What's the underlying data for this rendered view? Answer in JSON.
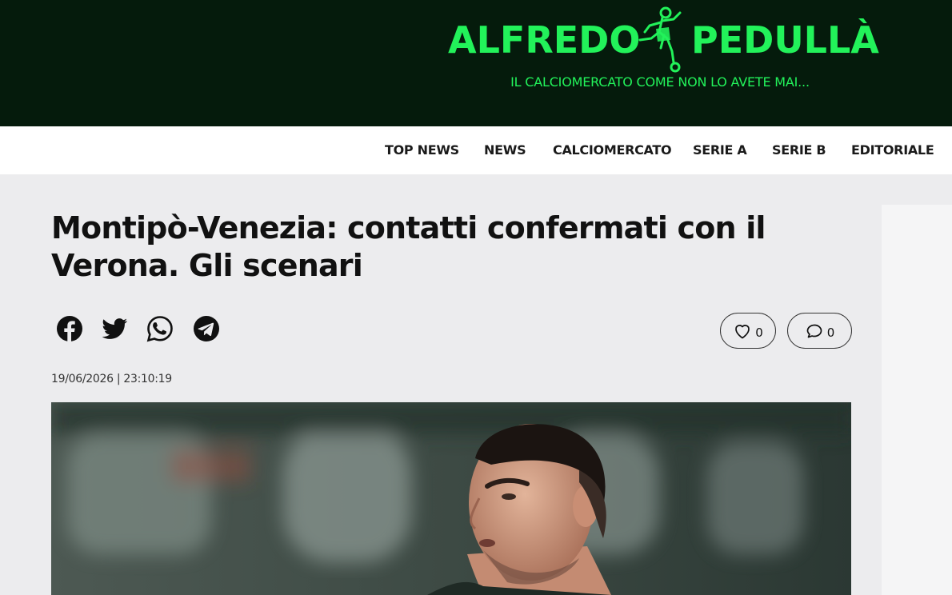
{
  "header": {
    "logo_left": "ALFREDO",
    "logo_right": "PEDULLÀ",
    "tagline": "IL CALCIOMERCATO COME NON LO AVETE MAI...",
    "logo_icon": "soccer-player-icon"
  },
  "nav": {
    "items": [
      "TOP NEWS",
      "NEWS",
      "CALCIOMERCATO",
      "SERIE A",
      "SERIE B",
      "EDITORIALE"
    ]
  },
  "article": {
    "title": "Montipò-Venezia: contatti confermati con il Verona. Gli scenari",
    "date": "19/06/2026 | 23:10:19",
    "likes": "0",
    "comments": "0",
    "share_icons": [
      "facebook-icon",
      "twitter-icon",
      "whatsapp-icon",
      "telegram-icon"
    ]
  },
  "colors": {
    "header_bg": "#051b0c",
    "brand_green": "#22f25a",
    "page_bg": "#ececee"
  }
}
